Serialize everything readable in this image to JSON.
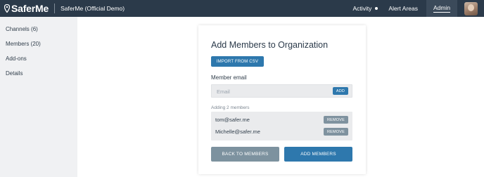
{
  "topbar": {
    "logo_text": "SaferMe",
    "org_name": "SaferMe (Official Demo)",
    "nav": {
      "activity": "Activity",
      "alert_areas": "Alert Areas",
      "admin": "Admin"
    }
  },
  "sidebar": {
    "items": [
      {
        "label": "Channels (6)"
      },
      {
        "label": "Members (20)"
      },
      {
        "label": "Add-ons"
      },
      {
        "label": "Details"
      }
    ]
  },
  "card": {
    "title": "Add Members to Organization",
    "import_button": "IMPORT FROM CSV",
    "email_label": "Member email",
    "email_placeholder": "Email",
    "email_value": "",
    "add_button": "ADD",
    "adding_label": "Adding 2 members",
    "members": [
      {
        "email": "tom@safer.me",
        "remove_label": "REMOVE"
      },
      {
        "email": "Michelle@safer.me",
        "remove_label": "REMOVE"
      }
    ],
    "back_button": "BACK TO MEMBERS",
    "add_members_button": "ADD MEMBERS"
  },
  "colors": {
    "topbar_bg": "#2b3a4a",
    "primary_button": "#2e78ad",
    "secondary_button": "#7d929f",
    "page_bg": "#f0f1f3"
  }
}
